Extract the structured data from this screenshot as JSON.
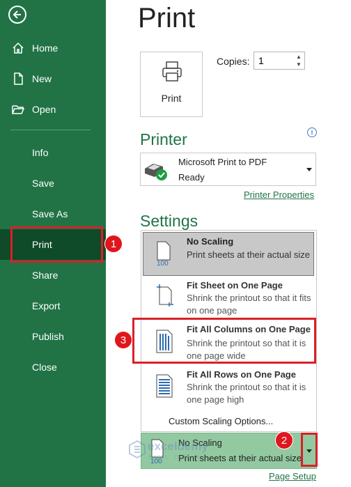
{
  "sidebar": {
    "items": [
      {
        "label": "Home",
        "icon": "home-icon"
      },
      {
        "label": "New",
        "icon": "new-document-icon"
      },
      {
        "label": "Open",
        "icon": "folder-open-icon"
      },
      {
        "label": "Info"
      },
      {
        "label": "Save"
      },
      {
        "label": "Save As"
      },
      {
        "label": "Print"
      },
      {
        "label": "Share"
      },
      {
        "label": "Export"
      },
      {
        "label": "Publish"
      },
      {
        "label": "Close"
      }
    ],
    "active": "Print"
  },
  "main": {
    "title": "Print",
    "print_button": "Print",
    "copies_label": "Copies:",
    "copies_value": "1",
    "printer_heading": "Printer",
    "printer_name": "Microsoft Print to PDF",
    "printer_status": "Ready",
    "printer_properties": "Printer Properties",
    "settings_heading": "Settings",
    "scaling_options": [
      {
        "title": "No Scaling",
        "desc": "Print sheets at their actual size"
      },
      {
        "title": "Fit Sheet on One Page",
        "desc": "Shrink the printout so that it fits on one page"
      },
      {
        "title": "Fit All Columns on One Page",
        "desc": "Shrink the printout so that it is one page wide"
      },
      {
        "title": "Fit All Rows on One Page",
        "desc": "Shrink the printout so that it is one page high"
      }
    ],
    "custom_scaling": "Custom Scaling Options...",
    "current_scaling": {
      "title": "No Scaling",
      "desc": "Print sheets at their actual size"
    },
    "page_setup": "Page Setup"
  },
  "annotations": {
    "badge1": "1",
    "badge2": "2",
    "badge3": "3"
  },
  "watermark": {
    "name": "exceldemy",
    "tagline": "EXCEL · DATA · BI"
  },
  "colors": {
    "brand": "#217346",
    "active": "#0f4a29",
    "highlight": "#d92027",
    "selected": "#93c9a1"
  }
}
